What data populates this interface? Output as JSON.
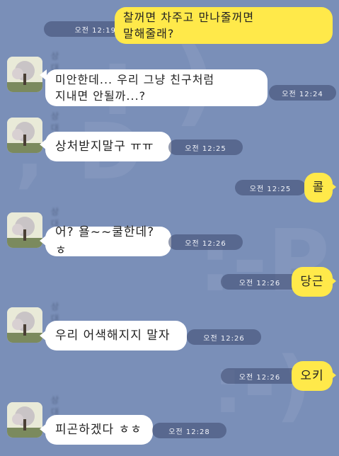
{
  "messages": [
    {
      "text": "찰꺼면 차주고 만나줄꺼면\n말해줄래?",
      "time": "오전 12:19"
    },
    {
      "sender": "상대",
      "text": "미안한데... 우리 그냥 친구처럼\n지내면 안될까...?",
      "time": "오전 12:24"
    },
    {
      "sender": "상대",
      "text": "상처받지말구 ㅠㅠ",
      "time": "오전 12:25"
    },
    {
      "text": "콜",
      "time": "오전 12:25"
    },
    {
      "sender": "상대",
      "text": "어? 욜~~쿨한데? ㅎ",
      "time": "오전 12:26"
    },
    {
      "text": "당근",
      "time": "오전 12:26"
    },
    {
      "sender": "상대",
      "text": "우리 어색해지지 말자",
      "time": "오전 12:26"
    },
    {
      "text": "오키",
      "time": "오전 12:26"
    },
    {
      "sender": "상대",
      "text": "피곤하겠다 ㅎㅎ",
      "time": "오전 12:28"
    }
  ],
  "colors": {
    "background": "#7a8fb8",
    "outgoing_bubble": "#ffe94a",
    "incoming_bubble": "#ffffff"
  }
}
